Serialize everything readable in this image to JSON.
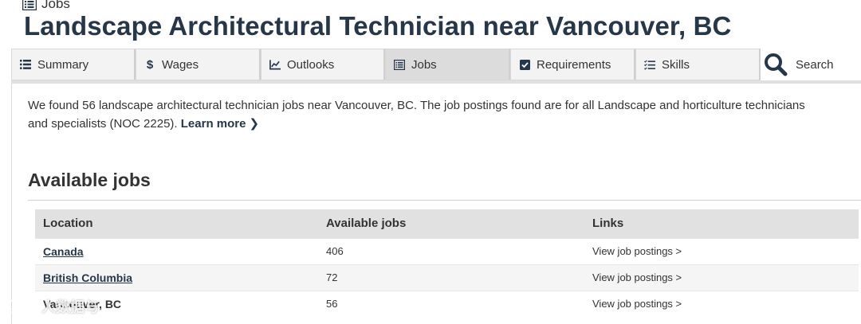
{
  "breadcrumb": {
    "label": "Jobs",
    "icon": "list-icon"
  },
  "page_title": "Landscape Architectural Technician near Vancouver, BC",
  "tabs": [
    {
      "label": "Summary",
      "icon": "list-icon",
      "active": false
    },
    {
      "label": "Wages",
      "icon": "dollar-icon",
      "active": false
    },
    {
      "label": "Outlooks",
      "icon": "line-chart-icon",
      "active": false
    },
    {
      "label": "Jobs",
      "icon": "list-icon",
      "active": true
    },
    {
      "label": "Requirements",
      "icon": "checkbox-icon",
      "active": false
    },
    {
      "label": "Skills",
      "icon": "checklist-icon",
      "active": false
    }
  ],
  "search": {
    "label": "Search",
    "icon": "search-icon"
  },
  "intro": {
    "text": "We found 56 landscape architectural technician jobs near Vancouver, BC. The job postings found are for all Landscape and horticulture technicians and specialists (NOC 2225).",
    "learn_more": "Learn more"
  },
  "section_title": "Available jobs",
  "table": {
    "headers": [
      "Location",
      "Available jobs",
      "Links"
    ],
    "rows": [
      {
        "location": "Canada",
        "count": "406",
        "link": "View job postings >"
      },
      {
        "location": "British Columbia",
        "count": "72",
        "link": "View job postings >"
      },
      {
        "location": "Vancouver, BC",
        "count": "56",
        "link": "View job postings >"
      }
    ]
  },
  "watermark": "人数据与"
}
